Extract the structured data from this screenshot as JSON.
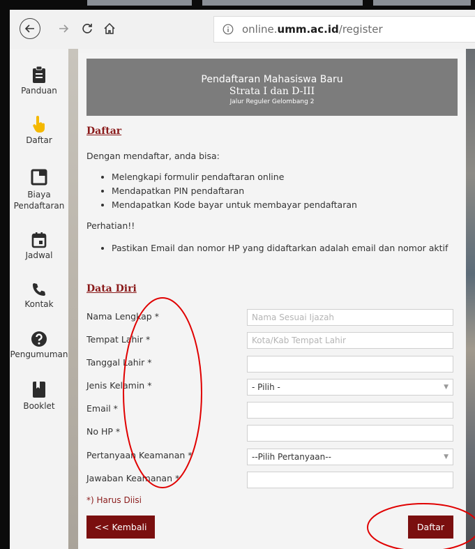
{
  "browser": {
    "url_prefix": "online.",
    "url_domain": "umm.ac.id",
    "url_path": "/register"
  },
  "sidebar": {
    "items": [
      {
        "label": "Panduan",
        "icon": "clipboard-icon"
      },
      {
        "label": "Daftar",
        "icon": "hand-pointer-icon"
      },
      {
        "label": "Biaya Pendaftaran",
        "icon": "window-icon"
      },
      {
        "label": "Jadwal",
        "icon": "calendar-icon"
      },
      {
        "label": "Kontak",
        "icon": "phone-icon"
      },
      {
        "label": "Pengumuman",
        "icon": "help-icon"
      },
      {
        "label": "Booklet",
        "icon": "book-icon"
      }
    ]
  },
  "banner": {
    "line1": "Pendaftaran Mahasiswa Baru",
    "line2": "Strata I dan D-III",
    "line3": "Jalur Reguler Gelombang 2"
  },
  "daftar": {
    "title": "Daftar",
    "intro": "Dengan mendaftar, anda bisa:",
    "bullets": [
      "Melengkapi formulir pendaftaran online",
      "Mendapatkan PIN pendaftaran",
      "Mendapatkan Kode bayar untuk membayar pendaftaran"
    ],
    "attention": "Perhatian!!",
    "attention_bullets": [
      "Pastikan Email dan nomor HP yang didaftarkan adalah email dan nomor aktif"
    ]
  },
  "data_diri": {
    "title": "Data Diri",
    "fields": {
      "nama": {
        "label": "Nama Lengkap *",
        "placeholder": "Nama Sesuai Ijazah",
        "value": ""
      },
      "tempat": {
        "label": "Tempat Lahir *",
        "placeholder": "Kota/Kab Tempat Lahir",
        "value": ""
      },
      "tanggal": {
        "label": "Tanggal Lahir *",
        "value": ""
      },
      "kelamin": {
        "label": "Jenis Kelamin *",
        "selected": "- Pilih -"
      },
      "email": {
        "label": "Email *",
        "value": ""
      },
      "hp": {
        "label": "No HP *",
        "value": ""
      },
      "pertanyaan": {
        "label": "Pertanyaan Keamanan *",
        "selected": "--Pilih Pertanyaan--"
      },
      "jawaban": {
        "label": "Jawaban Keamanan *",
        "value": ""
      }
    },
    "required_note": "*) Harus Diisi"
  },
  "buttons": {
    "back": "<< Kembali",
    "submit": "Daftar"
  },
  "colors": {
    "accent": "#7a0f0f",
    "banner": "#7c7c7c",
    "annotation": "#e00000"
  }
}
